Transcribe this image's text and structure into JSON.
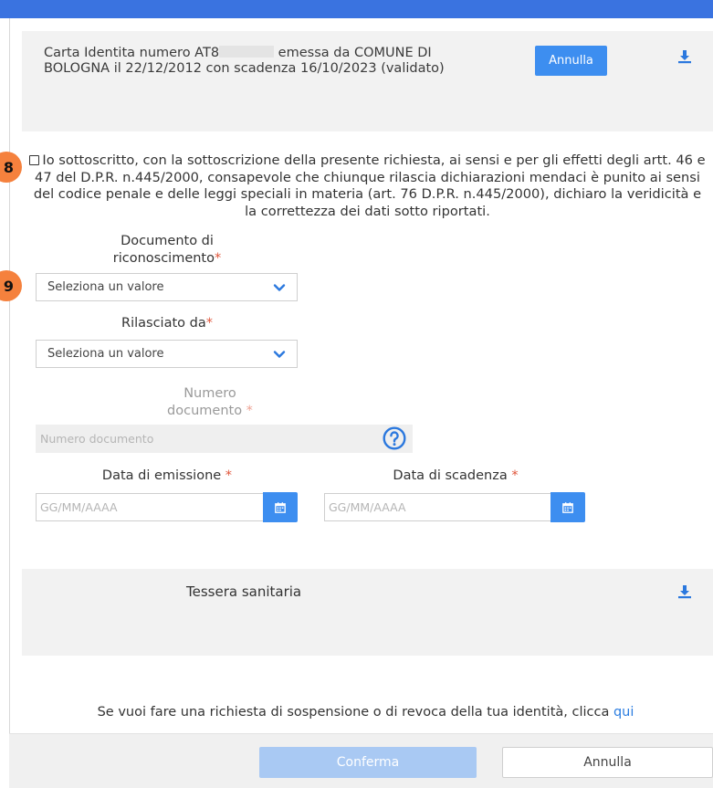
{
  "identity_card": {
    "text_before_redaction": "Carta Identita numero AT8",
    "text_after_redaction": "emessa da COMUNE DI BOLOGNA il 22/12/2012 con scadenza 16/10/2023 (validato)",
    "cancel_label": "Annulla",
    "download_icon": "download-icon"
  },
  "badges": {
    "declaration": "8",
    "document": "9"
  },
  "declaration": {
    "text": "Io sottoscritto, con la sottoscrizione della presente richiesta, ai sensi e per gli effetti degli artt. 46 e 47 del D.P.R. n.445/2000, consapevole che chiunque rilascia dichiarazioni mendaci è punito ai sensi del codice penale e delle leggi speciali in materia (art. 76 D.P.R. n.445/2000), dichiaro la veridicità e la correttezza dei dati sotto riportati."
  },
  "form": {
    "documento": {
      "label_line1": "Documento di",
      "label_line2": "riconoscimento",
      "required_mark": "*",
      "value": "Seleziona un valore"
    },
    "rilasciato": {
      "label": "Rilasciato da",
      "required_mark": "*",
      "value": "Seleziona un valore"
    },
    "numero": {
      "label_line1": "Numero",
      "label_line2": "documento",
      "required_mark": " *",
      "placeholder": "Numero documento"
    },
    "emissione": {
      "label": "Data di emissione",
      "required_mark": " *",
      "placeholder": "GG/MM/AAAA"
    },
    "scadenza": {
      "label": "Data di scadenza",
      "required_mark": " *",
      "placeholder": "GG/MM/AAAA"
    }
  },
  "health_card": {
    "title": "Tessera sanitaria"
  },
  "footer": {
    "note": "Se vuoi fare una richiesta di sospensione o di revoca della tua identità, clicca ",
    "link": "qui",
    "confirm_label": "Conferma",
    "cancel_label": "Annulla"
  },
  "colors": {
    "accent": "#3d8ef0",
    "top_bar": "#3a73e0",
    "badge": "#f5813d",
    "required": "#e0553a",
    "confirm_disabled": "#a9c9f3"
  }
}
